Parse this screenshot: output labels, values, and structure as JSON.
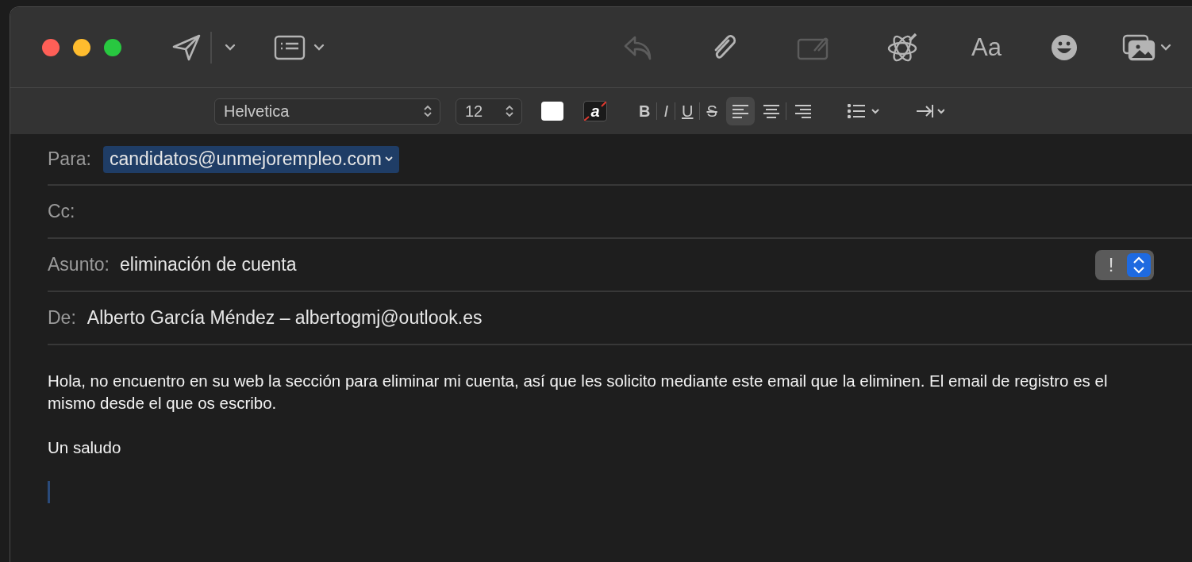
{
  "toolbar": {
    "left": [
      {
        "kind": "send",
        "disabled": false
      },
      {
        "kind": "header",
        "disabled": false
      }
    ],
    "right": [
      {
        "kind": "reply",
        "disabled": true
      },
      {
        "kind": "attach",
        "disabled": false
      },
      {
        "kind": "markup",
        "disabled": true
      },
      {
        "kind": "writing",
        "disabled": false
      },
      {
        "kind": "fonts",
        "label": "Aa",
        "disabled": false
      },
      {
        "kind": "emoji",
        "disabled": false
      },
      {
        "kind": "photo",
        "disabled": false
      }
    ]
  },
  "format_bar": {
    "font": "Helvetica",
    "size": "12",
    "highlight_label": "a",
    "styles": [
      {
        "kind": "bold",
        "label": "B"
      },
      {
        "kind": "italic",
        "label": "I"
      },
      {
        "kind": "underline",
        "label": "U"
      },
      {
        "kind": "strike",
        "label": "S"
      }
    ],
    "alignments": [
      {
        "kind": "left",
        "selected": true
      },
      {
        "kind": "center",
        "selected": false
      },
      {
        "kind": "right",
        "selected": false
      }
    ]
  },
  "fields": [
    {
      "kind": "recipient",
      "label": "Para:",
      "value": "candidatos@unmejorempleo.com"
    },
    {
      "kind": "text",
      "label": "Cc:"
    },
    {
      "kind": "subject",
      "label": "Asunto:",
      "value": "eliminación de cuenta",
      "priority": "!"
    },
    {
      "kind": "text",
      "label": "De:",
      "value": "Alberto García Méndez – albertogmj@outlook.es"
    }
  ],
  "body": [
    "Hola, no encuentro en su web la sección para eliminar mi cuenta, así que les solicito mediante este email que la eliminen. El email de registro es el mismo desde el que os escribo.",
    "Un saludo"
  ]
}
